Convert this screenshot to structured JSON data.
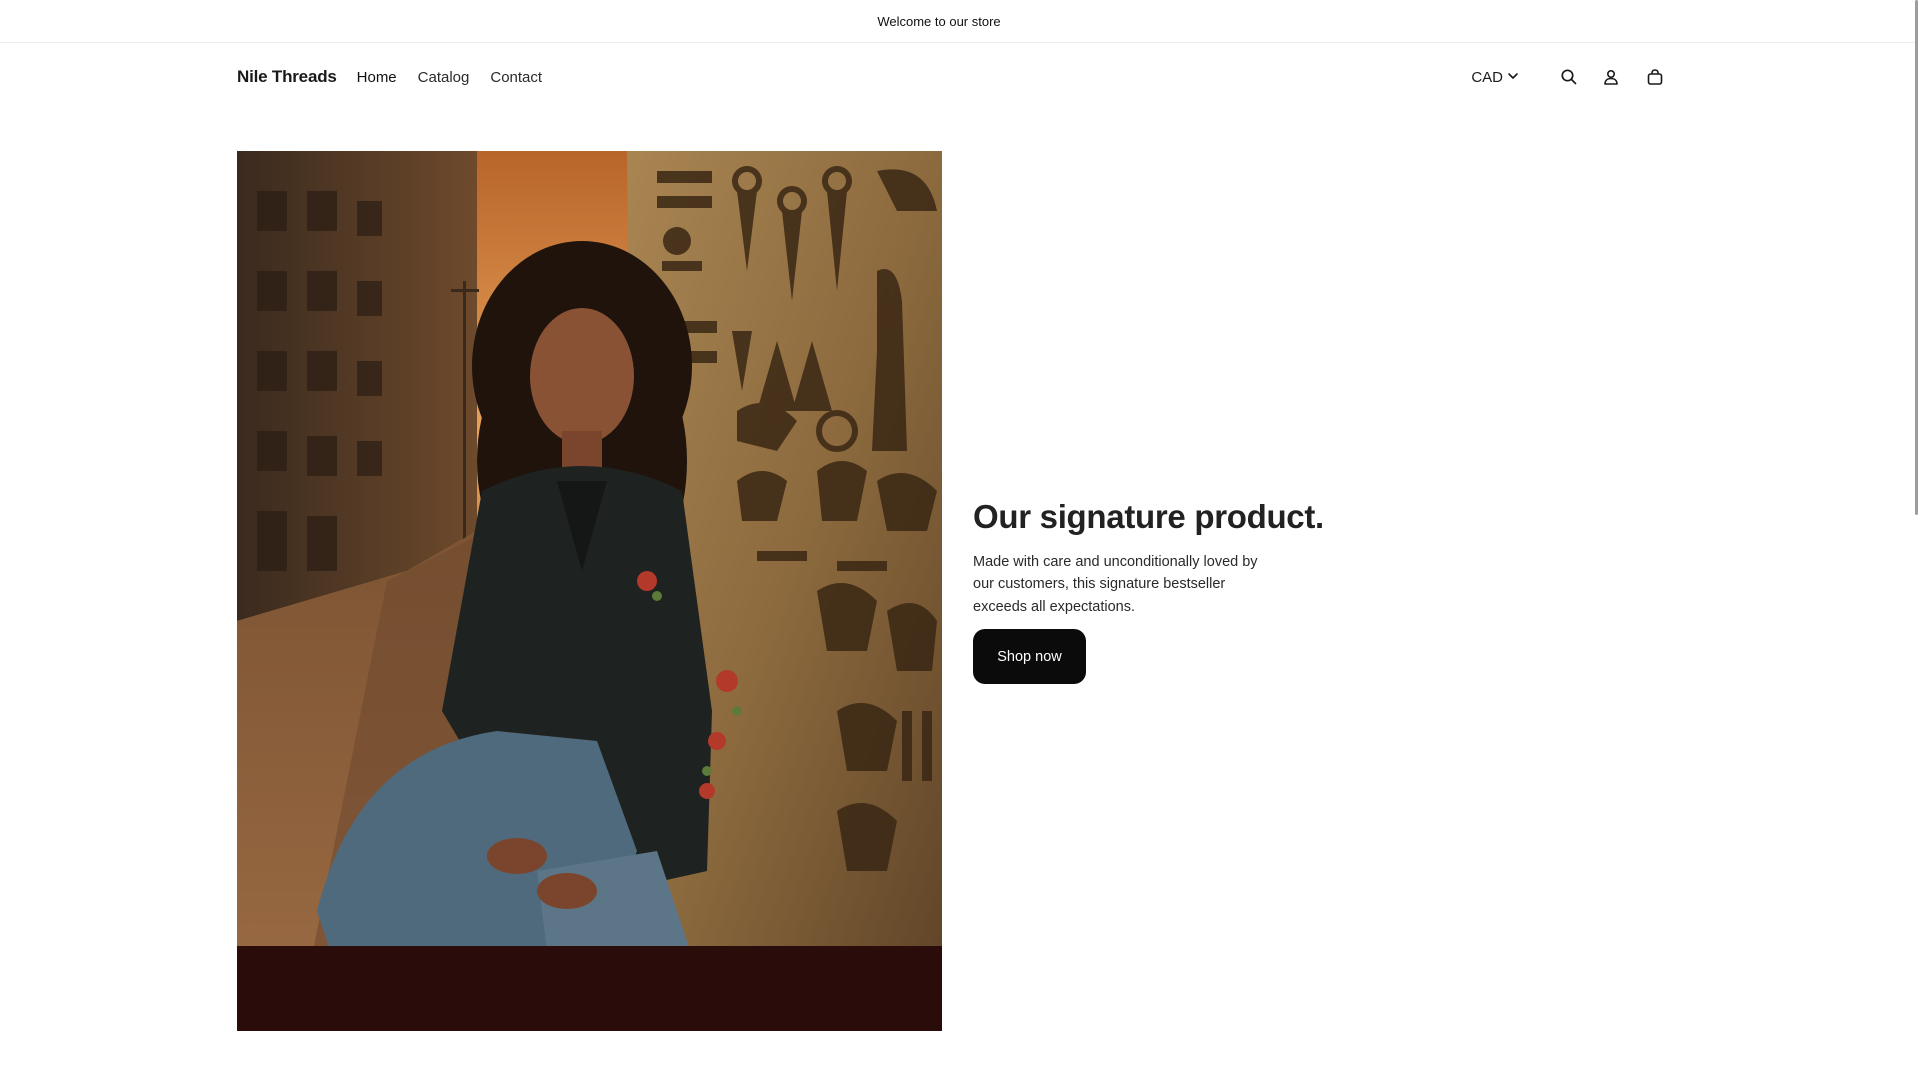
{
  "announcement": {
    "text": "Welcome to our store"
  },
  "header": {
    "brand": "Nile Threads",
    "nav": [
      {
        "label": "Home"
      },
      {
        "label": "Catalog"
      },
      {
        "label": "Contact"
      }
    ],
    "currency": "CAD",
    "icons": [
      "search-icon",
      "account-icon",
      "cart-icon"
    ]
  },
  "hero": {
    "title": "Our signature product.",
    "description": "Made with care and unconditionally loved by our customers, this signature bestseller exceeds all expectations.",
    "cta_label": "Shop now"
  },
  "colors": {
    "background": "#ffffff",
    "text": "#1f1f1f",
    "cta_background": "#0b0b0b",
    "cta_text": "#ffffff",
    "image_footer": "#2a0d0b"
  }
}
